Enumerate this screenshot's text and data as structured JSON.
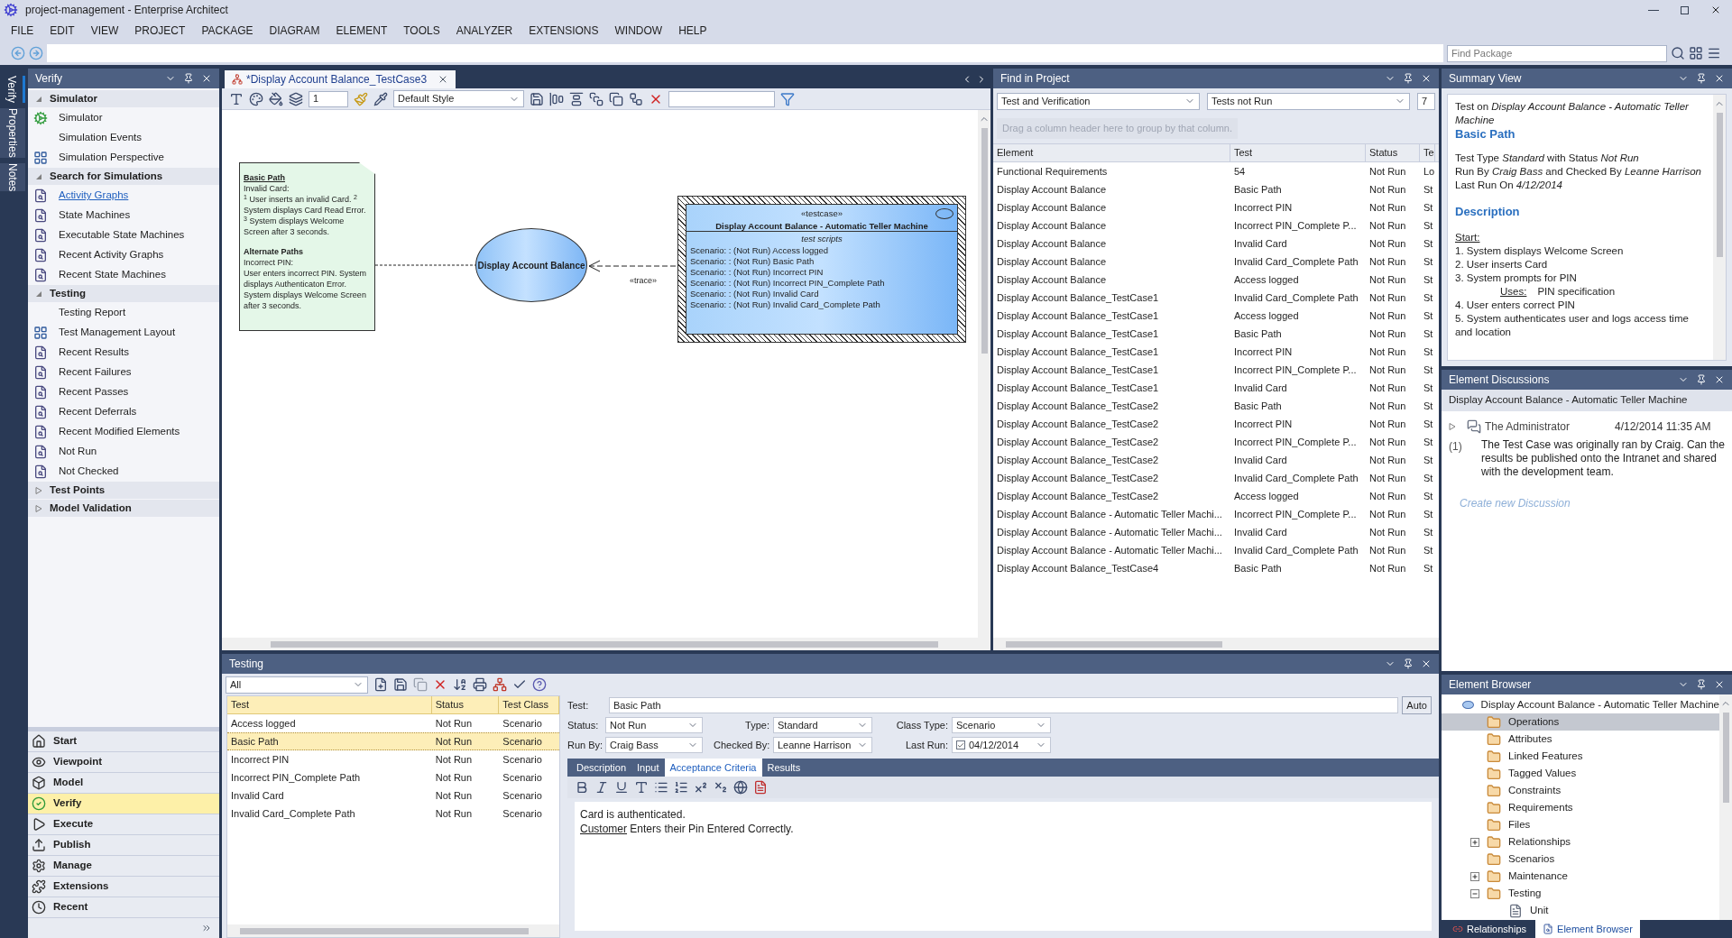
{
  "window": {
    "title": "project-management - Enterprise Architect"
  },
  "menu": [
    "FILE",
    "EDIT",
    "VIEW",
    "PROJECT",
    "PACKAGE",
    "DIAGRAM",
    "ELEMENT",
    "TOOLS",
    "ANALYZER",
    "EXTENSIONS",
    "WINDOW",
    "HELP"
  ],
  "find_package": {
    "placeholder": "Find Package"
  },
  "side_tabs": [
    {
      "label": "Verify",
      "selected": true
    },
    {
      "label": "Properties",
      "selected": false
    },
    {
      "label": "Notes",
      "selected": false
    }
  ],
  "verify_panel": {
    "title": "Verify",
    "groups": [
      {
        "label": "Simulator",
        "expanded": true,
        "items": [
          {
            "label": "Simulator",
            "kind": "simulator",
            "hovered": false
          },
          {
            "label": "Simulation Events",
            "kind": "plain",
            "hovered": false
          },
          {
            "label": "Simulation Perspective",
            "kind": "layout",
            "hovered": false
          }
        ]
      },
      {
        "label": "Search for Simulations",
        "expanded": true,
        "items": [
          {
            "label": "Activity Graphs",
            "kind": "search",
            "hovered": true
          },
          {
            "label": "State Machines",
            "kind": "search",
            "hovered": false
          },
          {
            "label": "Executable State Machines",
            "kind": "search",
            "hovered": false
          },
          {
            "label": "Recent Activity Graphs",
            "kind": "search",
            "hovered": false
          },
          {
            "label": "Recent State Machines",
            "kind": "search",
            "hovered": false
          }
        ]
      },
      {
        "label": "Testing",
        "expanded": true,
        "items": [
          {
            "label": "Testing Report",
            "kind": "plain",
            "hovered": false
          },
          {
            "label": "Test Management Layout",
            "kind": "layout",
            "hovered": false
          },
          {
            "label": "Recent Results",
            "kind": "search",
            "hovered": false
          },
          {
            "label": "Recent Failures",
            "kind": "search",
            "hovered": false
          },
          {
            "label": "Recent Passes",
            "kind": "search",
            "hovered": false
          },
          {
            "label": "Recent Deferrals",
            "kind": "search",
            "hovered": false
          },
          {
            "label": "Recent Modified Elements",
            "kind": "search",
            "hovered": false
          },
          {
            "label": "Not Run",
            "kind": "search",
            "hovered": false
          },
          {
            "label": "Not Checked",
            "kind": "search",
            "hovered": false
          }
        ]
      },
      {
        "label": "Test Points",
        "expanded": false
      },
      {
        "label": "Model Validation",
        "expanded": false
      }
    ]
  },
  "nav_buttons": [
    {
      "label": "Start",
      "kind": "start",
      "selected": false
    },
    {
      "label": "Viewpoint",
      "kind": "viewpoint",
      "selected": false
    },
    {
      "label": "Model",
      "kind": "model",
      "selected": false
    },
    {
      "label": "Verify",
      "kind": "verify",
      "selected": true
    },
    {
      "label": "Execute",
      "kind": "execute",
      "selected": false
    },
    {
      "label": "Publish",
      "kind": "publish",
      "selected": false
    },
    {
      "label": "Manage",
      "kind": "manage",
      "selected": false
    },
    {
      "label": "Extensions",
      "kind": "extensions",
      "selected": false
    },
    {
      "label": "Recent",
      "kind": "recent",
      "selected": false
    }
  ],
  "diagram": {
    "tab": "*Display Account Balance_TestCase3",
    "zoom": "1",
    "style": "Default Style",
    "note": {
      "title": "Basic Path",
      "lines": [
        "Invalid Card:",
        "$^{1}$ User inserts an invalid Card. $^{2}$ System displays Card Read Error. $^{3}$ System displays Welcome Screen after 3 seconds."
      ],
      "alt_title": "Alternate Paths",
      "alt_lines": [
        "Incorrect PIN:",
        "User enters incorrect PIN. System displays Authenticaton Error. System displays Welcome Screen after 3 seconds."
      ]
    },
    "use_case": "Display Account Balance",
    "test_case": {
      "stereotype": "«testcase»",
      "name": "Display Account Balance - Automatic Teller Machine",
      "section": "test scripts",
      "scripts": [
        "Scenario: : (Not Run) Access logged",
        "Scenario: : (Not Run) Basic Path",
        "Scenario: : (Not Run) Incorrect PIN",
        "Scenario: : (Not Run) Incorrect PIN_Complete Path",
        "Scenario: : (Not Run) Invalid Card",
        "Scenario: : (Not Run) Invalid Card_Complete Path"
      ]
    },
    "trace_label": "«trace»"
  },
  "find_in_project": {
    "title": "Find in Project",
    "category": "Test and Verification",
    "search": "Tests not Run",
    "option": "7",
    "group_hint": "Drag a column header here to group by that column.",
    "columns": [
      "Element",
      "Test",
      "Status",
      "Te"
    ],
    "rows": [
      [
        "Functional Requirements",
        "54",
        "Not Run",
        "Lo"
      ],
      [
        "Display Account Balance",
        "Basic Path",
        "Not Run",
        "St"
      ],
      [
        "Display Account Balance",
        "Incorrect PIN",
        "Not Run",
        "St"
      ],
      [
        "Display Account Balance",
        "Incorrect PIN_Complete P...",
        "Not Run",
        "St"
      ],
      [
        "Display Account Balance",
        "Invalid Card",
        "Not Run",
        "St"
      ],
      [
        "Display Account Balance",
        "Invalid Card_Complete Path",
        "Not Run",
        "St"
      ],
      [
        "Display Account Balance",
        "Access logged",
        "Not Run",
        "St"
      ],
      [
        "Display Account Balance_TestCase1",
        "Invalid Card_Complete Path",
        "Not Run",
        "St"
      ],
      [
        "Display Account Balance_TestCase1",
        "Access logged",
        "Not Run",
        "St"
      ],
      [
        "Display Account Balance_TestCase1",
        "Basic Path",
        "Not Run",
        "St"
      ],
      [
        "Display Account Balance_TestCase1",
        "Incorrect PIN",
        "Not Run",
        "St"
      ],
      [
        "Display Account Balance_TestCase1",
        "Incorrect PIN_Complete P...",
        "Not Run",
        "St"
      ],
      [
        "Display Account Balance_TestCase1",
        "Invalid Card",
        "Not Run",
        "St"
      ],
      [
        "Display Account Balance_TestCase2",
        "Basic Path",
        "Not Run",
        "St"
      ],
      [
        "Display Account Balance_TestCase2",
        "Incorrect PIN",
        "Not Run",
        "St"
      ],
      [
        "Display Account Balance_TestCase2",
        "Incorrect PIN_Complete P...",
        "Not Run",
        "St"
      ],
      [
        "Display Account Balance_TestCase2",
        "Invalid Card",
        "Not Run",
        "St"
      ],
      [
        "Display Account Balance_TestCase2",
        "Invalid Card_Complete Path",
        "Not Run",
        "St"
      ],
      [
        "Display Account Balance_TestCase2",
        "Access logged",
        "Not Run",
        "St"
      ],
      [
        "Display Account Balance - Automatic Teller Machi...",
        "Incorrect PIN_Complete P...",
        "Not Run",
        "St"
      ],
      [
        "Display Account Balance - Automatic Teller Machi...",
        "Invalid Card",
        "Not Run",
        "St"
      ],
      [
        "Display Account Balance - Automatic Teller Machi...",
        "Invalid Card_Complete Path",
        "Not Run",
        "St"
      ],
      [
        "Display Account Balance_TestCase4",
        "Basic Path",
        "Not Run",
        "St"
      ]
    ]
  },
  "summary": {
    "title": "Summary View",
    "intro": "Test on *Display Account Balance - Automatic Teller Machine*",
    "test_name": "Basic Path",
    "details": [
      "Test Type *Standard* with Status *Not Run*",
      "Run By *Craig Bass* and Checked By *Leanne Harrison*",
      "Last Run On *4/12/2014*"
    ],
    "description_heading": "Description",
    "start_label": "Start:",
    "steps": [
      {
        "kind": "step",
        "text": "1. System displays Welcome Screen"
      },
      {
        "kind": "step",
        "text": "2. User inserts Card"
      },
      {
        "kind": "step",
        "text": "3. System prompts for PIN"
      },
      {
        "kind": "uses",
        "label": "Uses:",
        "text": "PIN specification"
      },
      {
        "kind": "step",
        "text": "4. User enters correct PIN"
      },
      {
        "kind": "step",
        "text": "5. System authenticates user and logs access time and location"
      }
    ]
  },
  "discussions": {
    "title": "Element Discussions",
    "element": "Display Account Balance - Automatic Teller Machine",
    "posts": [
      {
        "author": "The Administrator",
        "time": "4/12/2014 11:35 AM",
        "count": "(1)",
        "message": "The Test Case was originally ran by Craig. Can the results be published onto the Intranet and shared with the development team.",
        "expanded": false
      }
    ],
    "new_link": "Create new Discussion"
  },
  "element_browser": {
    "title": "Element Browser",
    "root": {
      "label": "Display Account Balance - Automatic Teller Machine",
      "children": [
        {
          "label": "Operations",
          "selected": true
        },
        {
          "label": "Attributes",
          "selected": false
        },
        {
          "label": "Linked Features",
          "selected": false
        },
        {
          "label": "Tagged Values",
          "selected": false
        },
        {
          "label": "Constraints",
          "selected": false
        },
        {
          "label": "Requirements",
          "selected": false
        },
        {
          "label": "Files",
          "selected": false
        },
        {
          "label": "Relationships",
          "selected": false,
          "expanded": false
        },
        {
          "label": "Scenarios",
          "selected": false
        },
        {
          "label": "Maintenance",
          "selected": false,
          "expanded": false
        },
        {
          "label": "Testing",
          "selected": false,
          "expanded": true,
          "children": [
            {
              "label": "Unit",
              "selected": false,
              "kind": "document"
            }
          ]
        }
      ]
    }
  },
  "bottom_tabs": [
    {
      "label": "Relationships",
      "selected": false
    },
    {
      "label": "Element Browser",
      "selected": true
    }
  ],
  "testing": {
    "title": "Testing",
    "filter": "All",
    "columns": [
      "Test",
      "Status",
      "Test Class"
    ],
    "rows": [
      {
        "cells": [
          "Access logged",
          "Not Run",
          "Scenario"
        ],
        "selected": false
      },
      {
        "cells": [
          "Basic Path",
          "Not Run",
          "Scenario"
        ],
        "selected": true
      },
      {
        "cells": [
          "Incorrect PIN",
          "Not Run",
          "Scenario"
        ],
        "selected": false
      },
      {
        "cells": [
          "Incorrect PIN_Complete Path",
          "Not Run",
          "Scenario"
        ],
        "selected": false
      },
      {
        "cells": [
          "Invalid Card",
          "Not Run",
          "Scenario"
        ],
        "selected": false
      },
      {
        "cells": [
          "Invalid Card_Complete Path",
          "Not Run",
          "Scenario"
        ],
        "selected": false
      }
    ],
    "form": {
      "test_label": "Test:",
      "test": "Basic Path",
      "auto": "Auto",
      "status_label": "Status:",
      "status": "Not Run",
      "type_label": "Type:",
      "type": "Standard",
      "class_label": "Class Type:",
      "class_type": "Scenario",
      "run_by_label": "Run By:",
      "run_by": "Craig Bass",
      "checked_by_label": "Checked By:",
      "checked_by": "Leanne Harrison",
      "last_run_label": "Last Run:",
      "last_run": "04/12/2014",
      "last_run_checked": true
    },
    "tabs": [
      {
        "label": "Description",
        "selected": false
      },
      {
        "label": "Input",
        "selected": false
      },
      {
        "label": "Acceptance Criteria",
        "selected": true
      },
      {
        "label": "Results",
        "selected": false
      }
    ],
    "criteria": [
      {
        "text": "Card is authenticated."
      },
      {
        "link": "Customer",
        "text": "Enters their Pin Entered Correctly."
      }
    ]
  }
}
